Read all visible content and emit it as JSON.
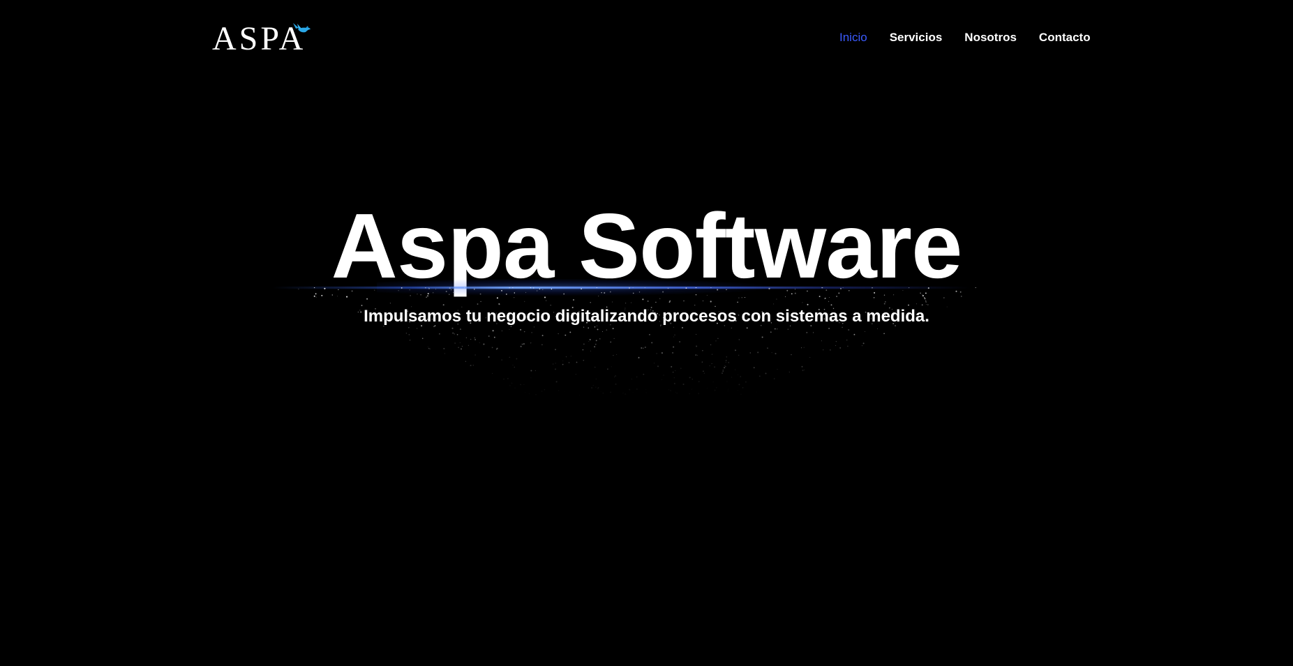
{
  "header": {
    "logo": {
      "text": "ASPA",
      "icon": "bird-icon",
      "accent_color": "#2aa8e8"
    },
    "nav": {
      "items": [
        {
          "label": "Inicio",
          "active": true
        },
        {
          "label": "Servicios",
          "active": false
        },
        {
          "label": "Nosotros",
          "active": false
        },
        {
          "label": "Contacto",
          "active": false
        }
      ],
      "active_color": "#3b5bff",
      "color": "#ffffff"
    }
  },
  "hero": {
    "title": "Aspa Software",
    "subtitle": "Impulsamos tu negocio digitalizando procesos con sistemas a medida.",
    "glow_color": "#5a86ff",
    "background": "#000000"
  }
}
